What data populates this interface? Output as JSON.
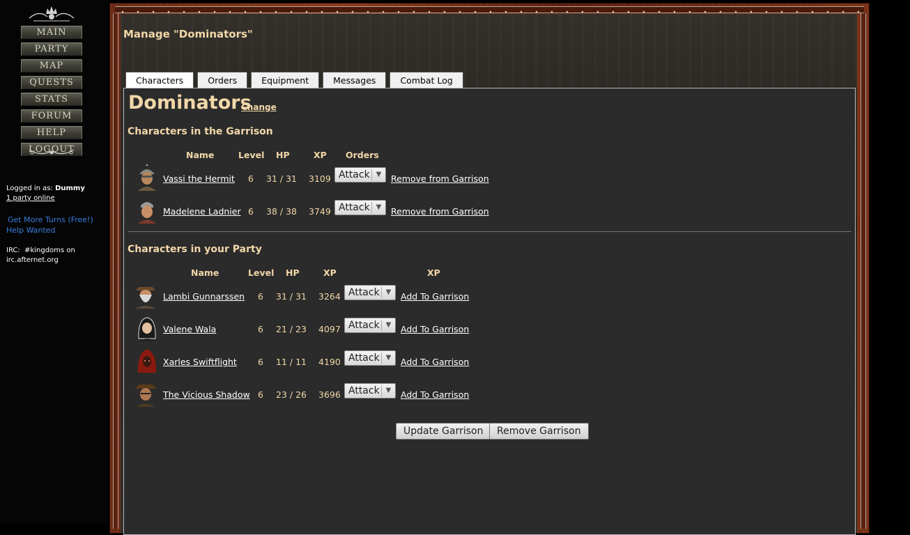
{
  "nav": {
    "main": "MAIN",
    "party": "PARTY",
    "map": "MAP",
    "quests": "QUESTS",
    "stats": "STATS",
    "forum": "FORUM",
    "help": "HELP",
    "logout": "LOGOUT"
  },
  "sidebar": {
    "logged_in_label": "Logged in as:",
    "username": "Dummy",
    "party_online": "1 party online",
    "get_turns": "Get More Turns (Free!)",
    "help_wanted": "Help Wanted",
    "irc_line1": "IRC:  #kingdoms on",
    "irc_line2": "irc.afternet.org"
  },
  "header": {
    "title": "Manage \"Dominators\""
  },
  "tabs": [
    "Characters",
    "Orders",
    "Equipment",
    "Messages",
    "Combat Log"
  ],
  "party": {
    "name": "Dominators",
    "change_label": "Change"
  },
  "garrison": {
    "heading": "Characters in the Garrison",
    "columns": {
      "name": "Name",
      "level": "Level",
      "hp": "HP",
      "xp": "XP",
      "orders": "Orders"
    },
    "rows": [
      {
        "name": "Vassi the Hermit",
        "level": "6",
        "hp": "31 / 31",
        "xp": "3109",
        "order": "Attack",
        "action": "Remove from Garrison"
      },
      {
        "name": "Madelene Ladnier",
        "level": "6",
        "hp": "38 / 38",
        "xp": "3749",
        "order": "Attack",
        "action": "Remove from Garrison"
      }
    ]
  },
  "party_section": {
    "heading": "Characters in your Party",
    "columns": {
      "name": "Name",
      "level": "Level",
      "hp": "HP",
      "xp": "XP",
      "orders": "XP"
    },
    "rows": [
      {
        "name": "Lambi Gunnarssen",
        "level": "6",
        "hp": "31 / 31",
        "xp": "3264",
        "order": "Attack",
        "action": "Add To Garrison"
      },
      {
        "name": "Valene Wala",
        "level": "6",
        "hp": "21 / 23",
        "xp": "4097",
        "order": "Attack",
        "action": "Add To Garrison"
      },
      {
        "name": "Xarles Swiftflight",
        "level": "6",
        "hp": "11 / 11",
        "xp": "4190",
        "order": "Attack",
        "action": "Add To Garrison"
      },
      {
        "name": "The Vicious Shadow",
        "level": "6",
        "hp": "23 / 26",
        "xp": "3696",
        "order": "Attack",
        "action": "Add To Garrison"
      }
    ]
  },
  "buttons": {
    "update": "Update Garrison",
    "remove": "Remove Garrison"
  },
  "colors": {
    "accent_text": "#f1d7a9",
    "link_blue": "#3d7fe0",
    "panel_bg": "#2b2b2b",
    "frame": "#7a3218"
  }
}
